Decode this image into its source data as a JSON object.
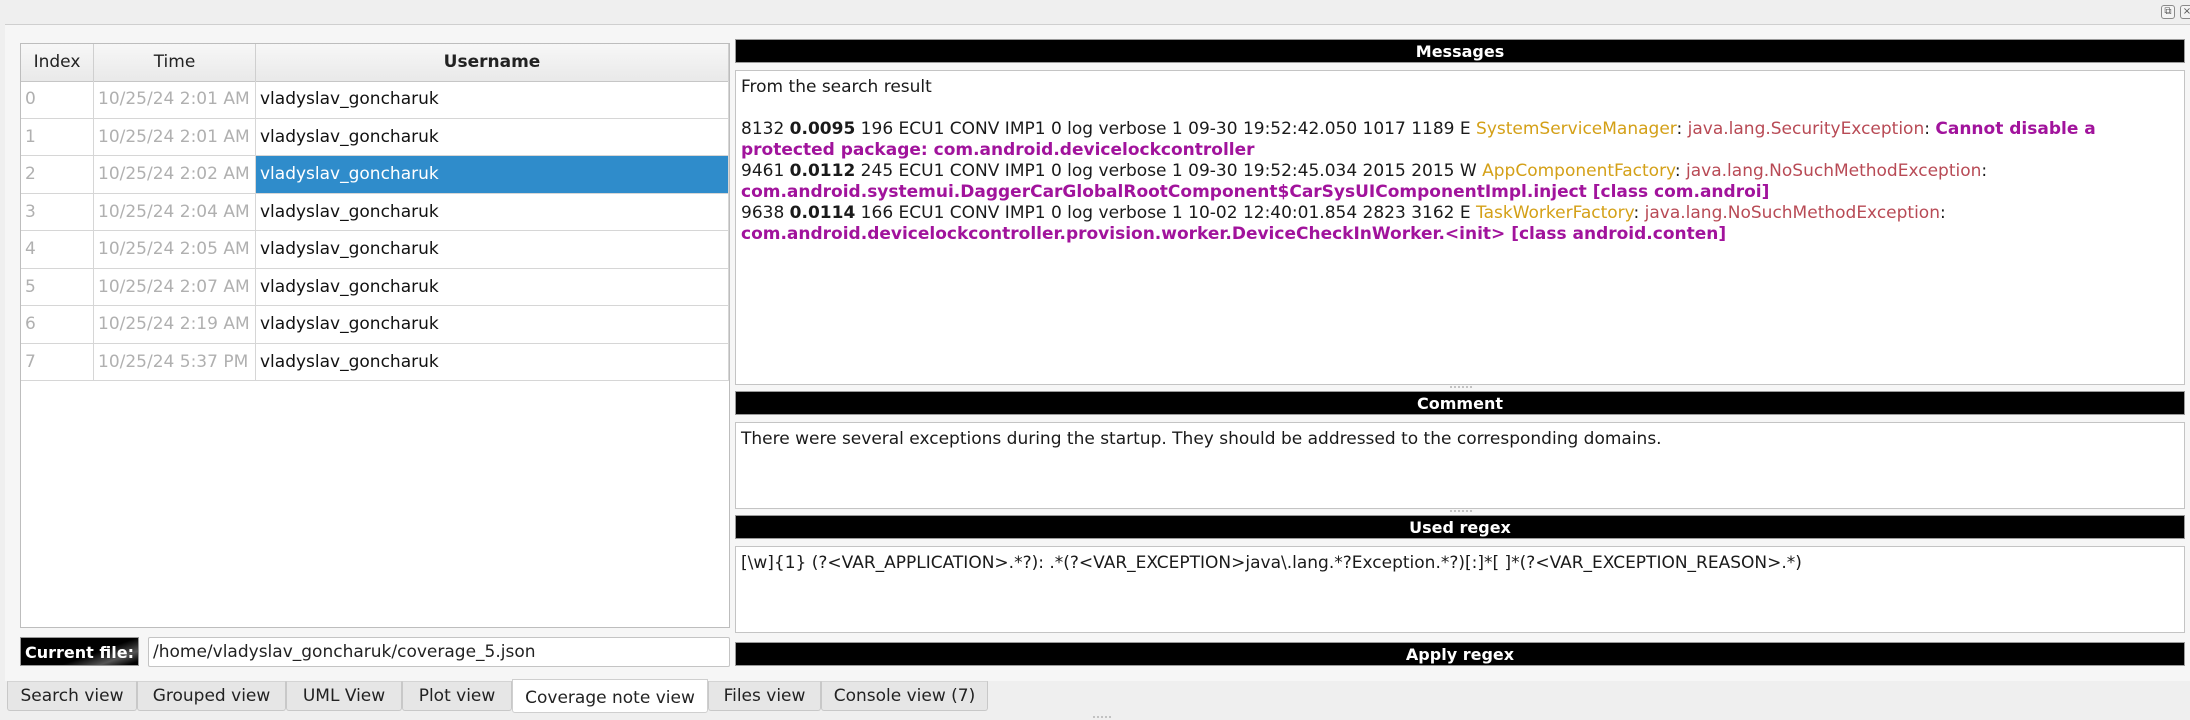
{
  "dock": {
    "float_icon": "float-icon",
    "close_icon": "close-icon"
  },
  "table": {
    "columns": [
      "Index",
      "Time",
      "Username"
    ],
    "rows": [
      {
        "index": "0",
        "time": "10/25/24 2:01 AM",
        "username": "vladyslav_goncharuk"
      },
      {
        "index": "1",
        "time": "10/25/24 2:01 AM",
        "username": "vladyslav_goncharuk"
      },
      {
        "index": "2",
        "time": "10/25/24 2:02 AM",
        "username": "vladyslav_goncharuk",
        "selected": true
      },
      {
        "index": "3",
        "time": "10/25/24 2:04 AM",
        "username": "vladyslav_goncharuk"
      },
      {
        "index": "4",
        "time": "10/25/24 2:05 AM",
        "username": "vladyslav_goncharuk"
      },
      {
        "index": "5",
        "time": "10/25/24 2:07 AM",
        "username": "vladyslav_goncharuk"
      },
      {
        "index": "6",
        "time": "10/25/24 2:19 AM",
        "username": "vladyslav_goncharuk"
      },
      {
        "index": "7",
        "time": "10/25/24 5:37 PM",
        "username": "vladyslav_goncharuk"
      }
    ],
    "selected_color": "#2f8ccb"
  },
  "current_file": {
    "label": "Current file:",
    "value": "/home/vladyslav_goncharuk/coverage_5.json"
  },
  "messages": {
    "title": "Messages",
    "intro": "From the search result",
    "entries": [
      {
        "prefix_a": "8132 ",
        "score": "0.0095",
        "prefix_b": " 196 ECU1 CONV IMP1 0 log verbose 1 09-30 19:52:42.050 1017 1189 E ",
        "application": "SystemServiceManager",
        "sep1": ": ",
        "exception": "java.lang.SecurityException",
        "sep2": ": ",
        "reason": "Cannot disable a protected package: com.android.devicelockcontroller"
      },
      {
        "prefix_a": "9461 ",
        "score": "0.0112",
        "prefix_b": " 245 ECU1 CONV IMP1 0 log verbose 1 09-30 19:52:45.034 2015 2015 W ",
        "application": "AppComponentFactory",
        "sep1": ": ",
        "exception": "java.lang.NoSuchMethodException",
        "sep2": ": ",
        "reason": "com.android.systemui.DaggerCarGlobalRootComponent$CarSysUIComponentImpl.inject [class com.androi]"
      },
      {
        "prefix_a": "9638 ",
        "score": "0.0114",
        "prefix_b": " 166 ECU1 CONV IMP1 0 log verbose 1 10-02 12:40:01.854 2823 3162 E ",
        "application": "TaskWorkerFactory",
        "sep1": ": ",
        "exception": "java.lang.NoSuchMethodException",
        "sep2": ": ",
        "reason": "com.android.devicelockcontroller.provision.worker.DeviceCheckInWorker.<init> [class android.conten]"
      }
    ],
    "colors": {
      "application": "#d4a017",
      "exception": "#b84a55",
      "reason": "#a1139c"
    }
  },
  "comment": {
    "title": "Comment",
    "text": "There were several exceptions during the startup. They should be addressed to the corresponding domains."
  },
  "regex": {
    "title": "Used regex",
    "text": "[\\w]{1} (?<VAR_APPLICATION>.*?): .*(?<VAR_EXCEPTION>java\\.lang.*?Exception.*?)[:]*[ ]*(?<VAR_EXCEPTION_REASON>.*)"
  },
  "apply_regex": {
    "label": "Apply regex"
  },
  "tabs": [
    {
      "label": "Search view"
    },
    {
      "label": "Grouped view"
    },
    {
      "label": "UML View"
    },
    {
      "label": "Plot view"
    },
    {
      "label": "Coverage note view",
      "active": true
    },
    {
      "label": "Files view"
    },
    {
      "label": "Console view (7)"
    }
  ]
}
